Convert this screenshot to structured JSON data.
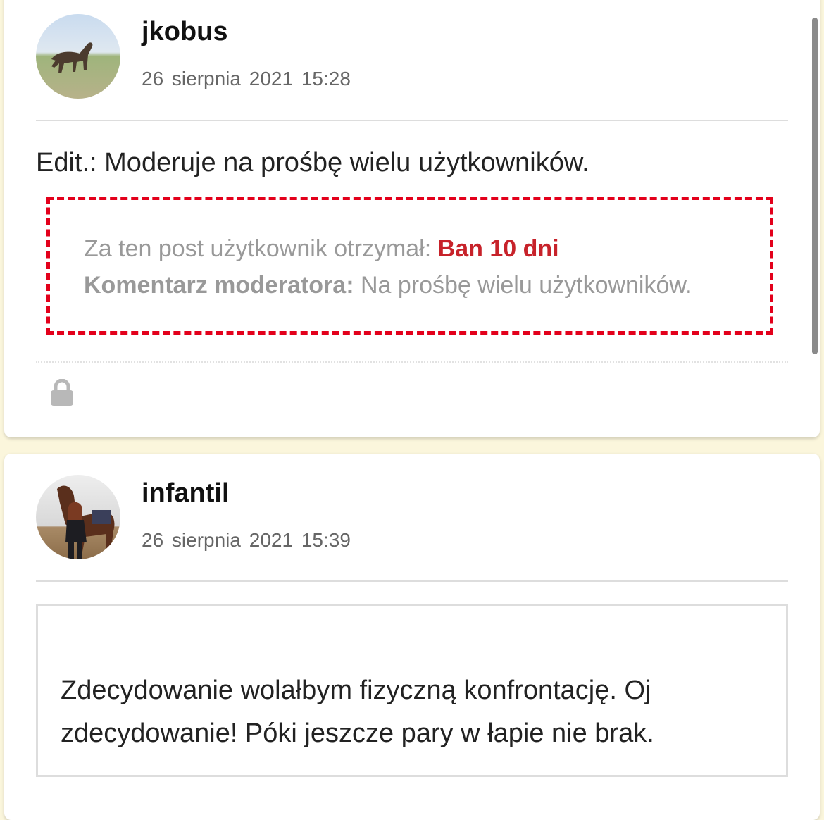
{
  "posts": [
    {
      "username": "jkobus",
      "date": "26 sierpnia 2021",
      "time": "15:28",
      "body": "Edit.: Moderuje na prośbę wielu użytkowników.",
      "moderation": {
        "prefix": "Za ten post użytkownik otrzymał:",
        "penalty": "Ban 10 dni",
        "comment_label": "Komentarz moderatora:",
        "comment": "Na prośbę wielu użytkowników."
      },
      "icon": "lock-icon"
    },
    {
      "username": "infantil",
      "date": "26 sierpnia 2021",
      "time": "15:39",
      "quote": "Zdecydowanie wolałbym fizyczną konfrontację. Oj zdecydowanie! Póki jeszcze pary w łapie nie brak."
    }
  ],
  "colors": {
    "page_background": "#fbf6dc",
    "ban_red": "#c7222a",
    "dashed_border": "#e3001b"
  }
}
